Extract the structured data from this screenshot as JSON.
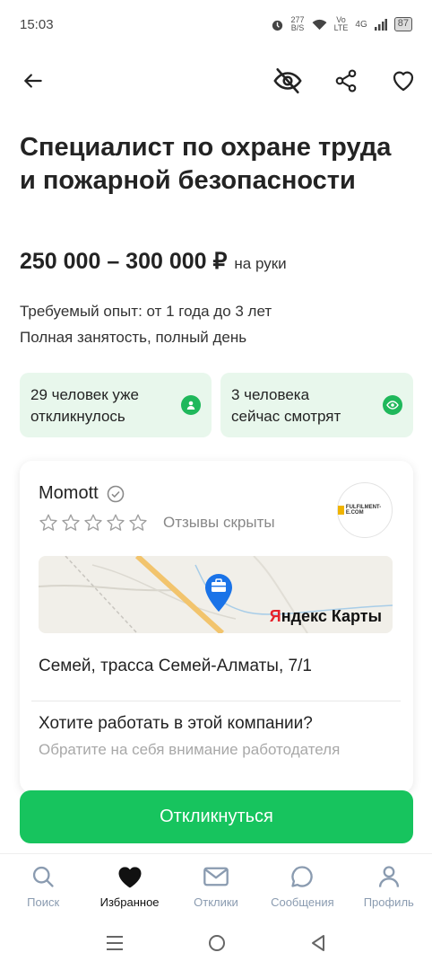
{
  "status_bar": {
    "time": "15:03",
    "net_speed_value": "277",
    "net_speed_unit": "B/S",
    "volte_top": "Vo",
    "volte_bottom": "LTE",
    "signal": "4G",
    "battery": "87"
  },
  "toolbar": {
    "back_icon": "arrow-left-icon",
    "hide_icon": "eye-off-icon",
    "share_icon": "share-icon",
    "favorite_icon": "heart-outline-icon"
  },
  "vacancy": {
    "title": "Специалист по охране труда и пожарной безопасности",
    "salary": "250 000 – 300 000 ₽",
    "salary_note": "на руки",
    "experience": "Требуемый опыт: от 1 года до 3 лет",
    "employment": "Полная занятость, полный день"
  },
  "stats": {
    "responded_line1": "29 человек уже",
    "responded_line2": "откликнулось",
    "watching_line1": "3 человека",
    "watching_line2": "сейчас смотрят",
    "accent_bg": "#e8f7ec",
    "accent_icon": "#1fb85b"
  },
  "company": {
    "name": "Momott",
    "verified_icon": "check-circle-icon",
    "rating_stars": 0,
    "rating_max": 5,
    "reviews_text": "Отзывы скрыты",
    "logo_text": "FULFILMENT-E.COM",
    "map_brand_red": "Я",
    "map_brand_rest": "ндекс Карты",
    "address": "Семей, трасса Семей-Алматы, 7/1",
    "question": "Хотите работать в этой компании?",
    "question_hint": "Обратите на себя внимание работодателя"
  },
  "apply": {
    "label": "Откликнуться",
    "color": "#17c45e"
  },
  "bottom_nav": {
    "items": [
      {
        "label": "Поиск",
        "icon": "search-icon"
      },
      {
        "label": "Избранное",
        "icon": "heart-filled-icon"
      },
      {
        "label": "Отклики",
        "icon": "mail-icon"
      },
      {
        "label": "Сообщения",
        "icon": "chat-icon"
      },
      {
        "label": "Профиль",
        "icon": "user-icon"
      }
    ],
    "active_index": 1
  }
}
